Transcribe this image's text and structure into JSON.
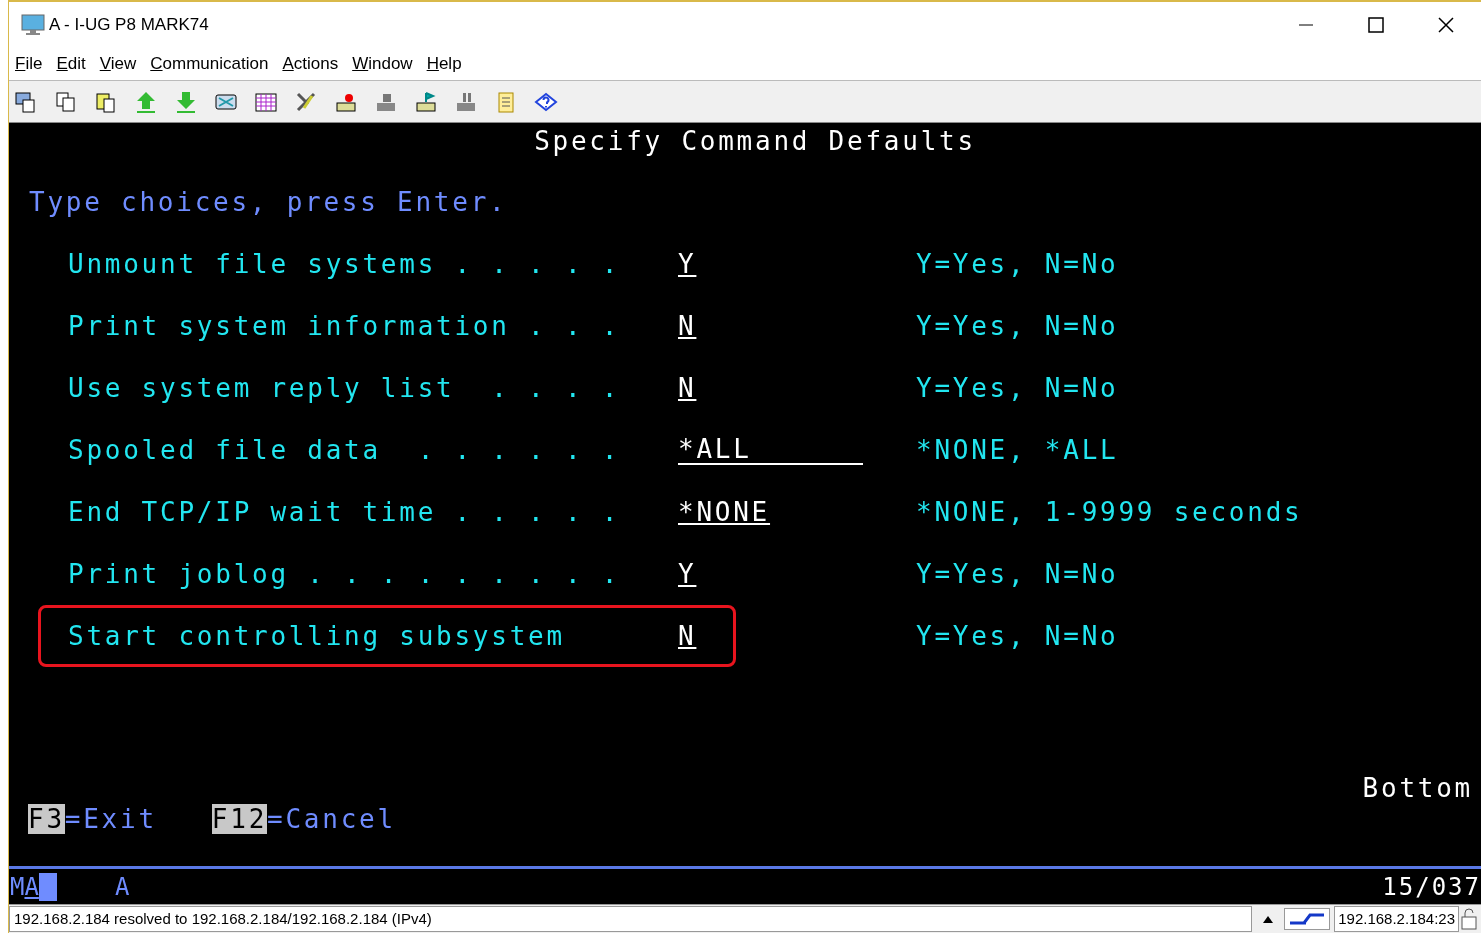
{
  "window": {
    "title": "A - I-UG P8 MARK74"
  },
  "menu": [
    "File",
    "Edit",
    "View",
    "Communication",
    "Actions",
    "Window",
    "Help"
  ],
  "screen": {
    "title": "Specify Command Defaults",
    "instruction": "Type choices, press Enter.",
    "fields": [
      {
        "label": "Unmount file systems . . . . .",
        "value": "Y",
        "hint": "Y=Yes, N=No",
        "kind": "short",
        "highlighted": false
      },
      {
        "label": "Print system information . . .",
        "value": "N",
        "hint": "Y=Yes, N=No",
        "kind": "short",
        "highlighted": false
      },
      {
        "label": "Use system reply list  . . . .",
        "value": "N",
        "hint": "Y=Yes, N=No",
        "kind": "short",
        "highlighted": false
      },
      {
        "label": "Spooled file data  . . . . . .",
        "value": "*ALL",
        "hint": "*NONE, *ALL",
        "kind": "long",
        "highlighted": false
      },
      {
        "label": "End TCP/IP wait time . . . . .",
        "value": "*NONE",
        "hint": "*NONE, 1-9999 seconds",
        "kind": "short",
        "highlighted": false
      },
      {
        "label": "Print joblog . . . . . . . . .",
        "value": "Y",
        "hint": "Y=Yes, N=No",
        "kind": "short",
        "highlighted": false
      },
      {
        "label": "Start controlling subsystem",
        "value": "N",
        "hint": "Y=Yes, N=No",
        "kind": "short",
        "highlighted": true
      }
    ],
    "position_label": "Bottom",
    "function_keys": [
      {
        "key": "F3",
        "action": "=Exit"
      },
      {
        "key": "F12",
        "action": "=Cancel"
      }
    ]
  },
  "oia": {
    "mode": "M",
    "mode_flag": "A",
    "session": "A",
    "cursor_position": "15/037"
  },
  "status_bar": {
    "message": "192.168.2.184 resolved to 192.168.2.184/192.168.2.184 (IPv4)",
    "host": "192.168.2.184:23"
  }
}
